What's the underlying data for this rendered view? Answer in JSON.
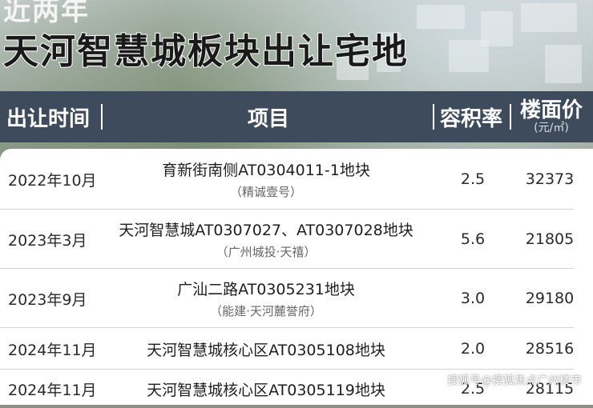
{
  "headline": {
    "top_line": "近两年",
    "main_title": "天河智慧城板块出让宅地"
  },
  "table": {
    "headers": {
      "date": "出让时间",
      "project": "项目",
      "far": "容积率",
      "price": "楼面价",
      "price_unit": "(元/㎡)"
    },
    "rows": [
      {
        "date": "2022年10月",
        "name": "育新街南侧AT0304011-1地块",
        "sub": "（精诚壹号）",
        "far": "2.5",
        "price": "32373"
      },
      {
        "date": "2023年3月",
        "name": "天河智慧城AT0307027、AT0307028地块",
        "sub": "（广州城投·天禧）",
        "far": "5.6",
        "price": "21805"
      },
      {
        "date": "2023年9月",
        "name": "广汕二路AT0305231地块",
        "sub": "（能建·天河麓誉府）",
        "far": "3.0",
        "price": "29180"
      },
      {
        "date": "2024年11月",
        "name": "天河智慧城核心区AT0305108地块",
        "sub": "",
        "far": "2.0",
        "price": "28516"
      },
      {
        "date": "2024年11月",
        "name": "天河智慧城核心区AT0305119地块",
        "sub": "",
        "far": "2.5",
        "price": "28115"
      }
    ]
  },
  "watermark": "搜狐号@搜狐焦点广州楼市"
}
